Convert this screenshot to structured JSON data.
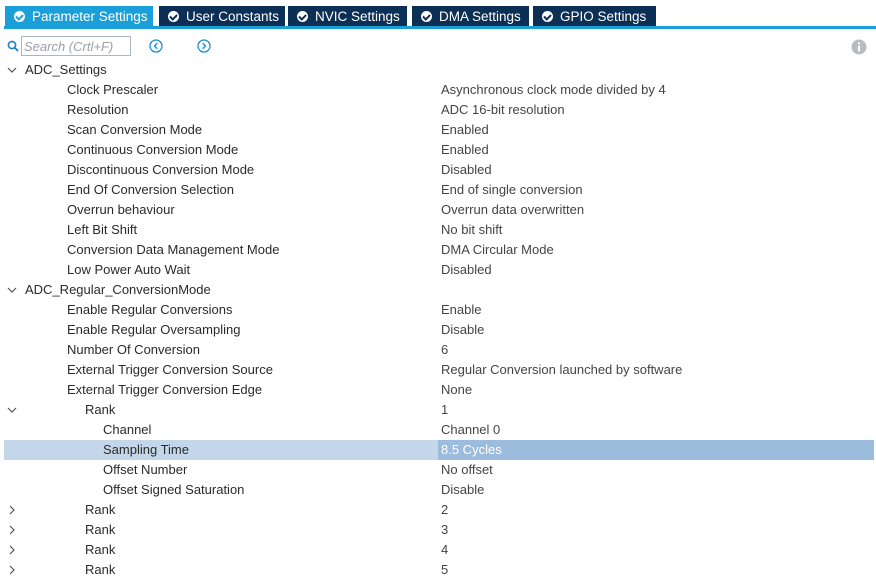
{
  "tabs": [
    {
      "label": "Parameter Settings",
      "active": true
    },
    {
      "label": "User Constants",
      "active": false
    },
    {
      "label": "NVIC Settings",
      "active": false
    },
    {
      "label": "DMA Settings",
      "active": false
    },
    {
      "label": "GPIO Settings",
      "active": false
    }
  ],
  "search": {
    "placeholder": "Search (Crtl+F)"
  },
  "colors": {
    "tab_active": "#1a9fd9",
    "tab_inactive": "#0c2f55",
    "selected_row": "#c4d7ea"
  },
  "tree": {
    "rows": [
      {
        "label": "ADC_Settings",
        "value": "",
        "level": 0,
        "toggle": "expanded"
      },
      {
        "label": "Clock Prescaler",
        "value": "Asynchronous clock mode divided by 4",
        "level": 1
      },
      {
        "label": "Resolution",
        "value": "ADC 16-bit resolution",
        "level": 1
      },
      {
        "label": "Scan Conversion Mode",
        "value": "Enabled",
        "level": 1
      },
      {
        "label": "Continuous Conversion Mode",
        "value": "Enabled",
        "level": 1
      },
      {
        "label": "Discontinuous Conversion Mode",
        "value": "Disabled",
        "level": 1
      },
      {
        "label": "End Of Conversion Selection",
        "value": "End of single conversion",
        "level": 1
      },
      {
        "label": "Overrun behaviour",
        "value": "Overrun data overwritten",
        "level": 1
      },
      {
        "label": "Left Bit Shift",
        "value": "No bit shift",
        "level": 1
      },
      {
        "label": "Conversion Data Management Mode",
        "value": "DMA Circular Mode",
        "level": 1
      },
      {
        "label": "Low Power Auto Wait",
        "value": "Disabled",
        "level": 1
      },
      {
        "label": "ADC_Regular_ConversionMode",
        "value": "",
        "level": 0,
        "toggle": "expanded"
      },
      {
        "label": "Enable Regular Conversions",
        "value": "Enable",
        "level": 1
      },
      {
        "label": "Enable Regular Oversampling",
        "value": "Disable",
        "level": 1
      },
      {
        "label": "Number Of Conversion",
        "value": "6",
        "level": 1
      },
      {
        "label": "External Trigger Conversion Source",
        "value": "Regular Conversion launched by software",
        "level": 1
      },
      {
        "label": "External Trigger Conversion Edge",
        "value": "None",
        "level": 1
      },
      {
        "label": "Rank",
        "value": "1",
        "level": 2,
        "toggle": "expanded"
      },
      {
        "label": "Channel",
        "value": "Channel 0",
        "level": 3
      },
      {
        "label": "Sampling Time",
        "value": "8.5 Cycles",
        "level": 3,
        "selected": true
      },
      {
        "label": "Offset Number",
        "value": "No offset",
        "level": 3
      },
      {
        "label": "Offset Signed Saturation",
        "value": "Disable",
        "level": 3
      },
      {
        "label": "Rank",
        "value": "2",
        "level": 2,
        "toggle": "collapsed"
      },
      {
        "label": "Rank",
        "value": "3",
        "level": 2,
        "toggle": "collapsed"
      },
      {
        "label": "Rank",
        "value": "4",
        "level": 2,
        "toggle": "collapsed"
      },
      {
        "label": "Rank",
        "value": "5",
        "level": 2,
        "toggle": "collapsed"
      }
    ]
  }
}
